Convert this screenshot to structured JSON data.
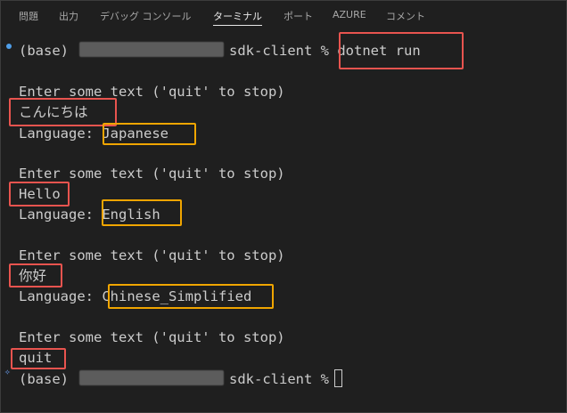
{
  "tabs": [
    {
      "label": "問題",
      "active": false
    },
    {
      "label": "出力",
      "active": false
    },
    {
      "label": "デバッグ コンソール",
      "active": false
    },
    {
      "label": "ターミナル",
      "active": true
    },
    {
      "label": "ポート",
      "active": false
    },
    {
      "label": "AZURE",
      "active": false
    },
    {
      "label": "コメント",
      "active": false
    }
  ],
  "terminal": {
    "env": "(base)",
    "dir": "sdk-client %",
    "command": "dotnet run",
    "prompt_text": "Enter some text ('quit' to stop)",
    "language_label": "Language:",
    "exchanges": [
      {
        "input": "こんにちは",
        "language": "Japanese"
      },
      {
        "input": "Hello",
        "language": "English"
      },
      {
        "input": "你好",
        "language": "Chinese_Simplified"
      }
    ],
    "quit_input": "quit"
  },
  "colors": {
    "background": "#1f1f1f",
    "text": "#cccccc",
    "highlight_red": "#e8544f",
    "highlight_yellow": "#f0a500",
    "status_dot": "#4f9ee8"
  }
}
